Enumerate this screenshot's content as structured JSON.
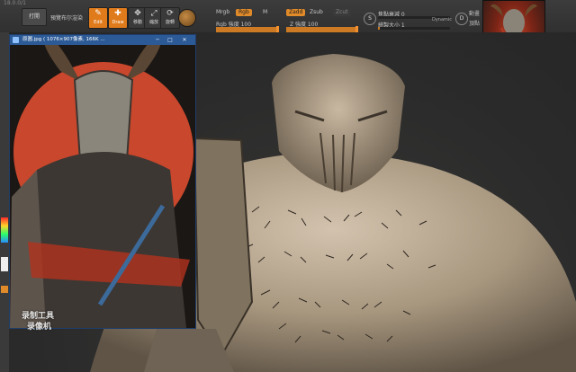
{
  "window": {
    "title_fragment": "18.0.0/1"
  },
  "toolbar": {
    "open_label": "打開",
    "preview_label": "預覽布尔渲染",
    "tools": [
      {
        "label": "Edit",
        "active": true
      },
      {
        "label": "Draw",
        "active": true
      },
      {
        "label": "移動",
        "active": false
      },
      {
        "label": "縮放",
        "active": false
      },
      {
        "label": "旋轉",
        "active": false
      }
    ],
    "mrgb_label": "Mrgb",
    "rgb_label": "Rgb",
    "m_label": "M",
    "zadd_label": "Zadd",
    "zsub_label": "Zsub",
    "zcut_label": "Zcut",
    "rgb_intensity_label": "Rgb 強度 100",
    "rgb_intensity_value": 100,
    "z_intensity_label": "Z 強度 100",
    "z_intensity_value": 100,
    "focal_label": "焦點衰減 0",
    "draw_size_label": "繪製大小 1",
    "dynamic_label": "Dynamic",
    "s_label": "S",
    "d_label": "D",
    "right_label_1": "動畫",
    "right_label_2": "頂點"
  },
  "viewer": {
    "title": "原圖.jpg ( 1076×907像素, 166K ...",
    "controls": [
      "─",
      "□",
      "✕"
    ]
  },
  "watermark": {
    "line1": "录制工具",
    "line2": "录像机"
  },
  "colors": {
    "accent": "#e08a2a",
    "viewer_titlebar": "#2c5a96",
    "clay": "#b7a691",
    "panel": "#303030"
  }
}
